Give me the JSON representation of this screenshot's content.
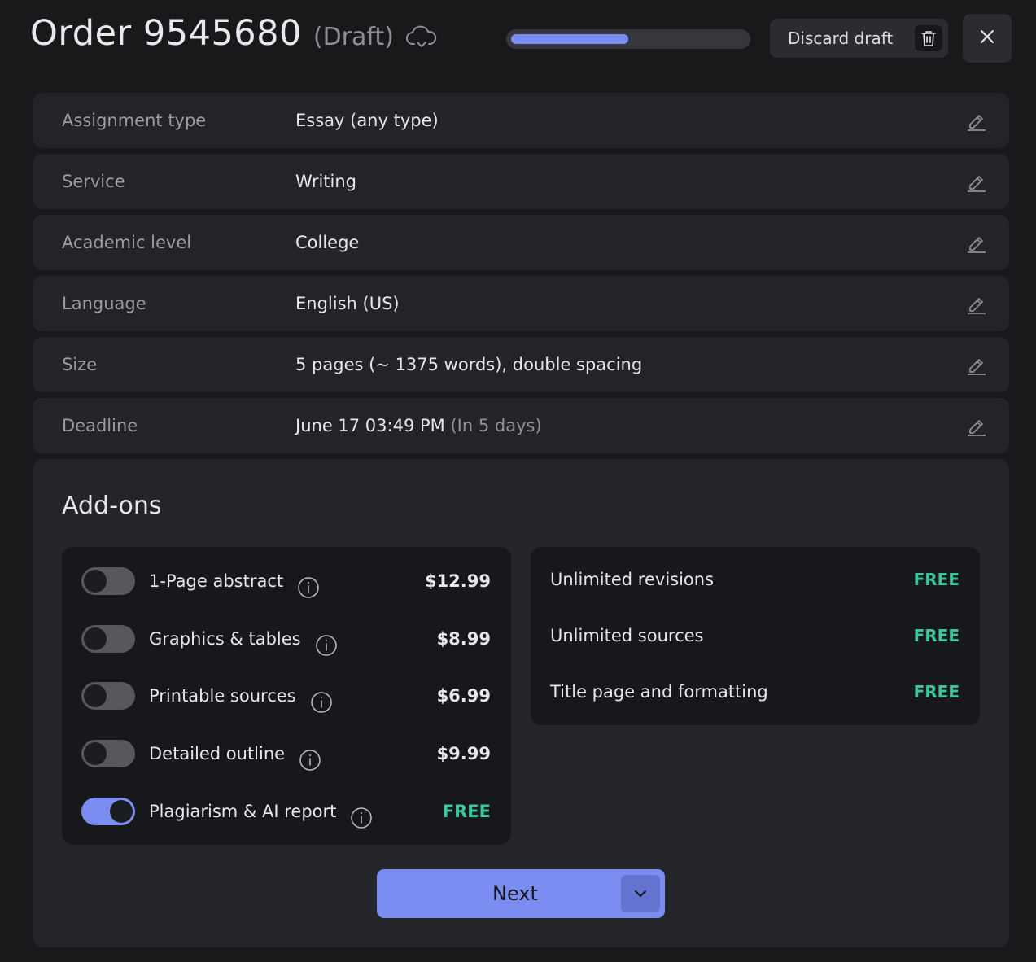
{
  "header": {
    "title": "Order 9545680",
    "status": "(Draft)",
    "progress_percent": 50,
    "discard_label": "Discard draft"
  },
  "details": [
    {
      "label": "Assignment type",
      "value": "Essay (any type)",
      "note": ""
    },
    {
      "label": "Service",
      "value": "Writing",
      "note": ""
    },
    {
      "label": "Academic level",
      "value": "College",
      "note": ""
    },
    {
      "label": "Language",
      "value": "English (US)",
      "note": ""
    },
    {
      "label": "Size",
      "value": "5 pages (~ 1375 words), double spacing",
      "note": ""
    },
    {
      "label": "Deadline",
      "value": "June 17 03:49 PM",
      "note": "(In 5 days)"
    }
  ],
  "addons": {
    "title": "Add-ons",
    "paid": [
      {
        "name": "1-Page abstract",
        "price": "$12.99",
        "enabled": false
      },
      {
        "name": "Graphics & tables",
        "price": "$8.99",
        "enabled": false
      },
      {
        "name": "Printable sources",
        "price": "$6.99",
        "enabled": false
      },
      {
        "name": "Detailed outline",
        "price": "$9.99",
        "enabled": false
      },
      {
        "name": "Plagiarism & AI report",
        "price": "FREE",
        "enabled": true
      }
    ],
    "included": [
      {
        "name": "Unlimited revisions",
        "price": "FREE"
      },
      {
        "name": "Unlimited sources",
        "price": "FREE"
      },
      {
        "name": "Title page and formatting",
        "price": "FREE"
      }
    ]
  },
  "footer": {
    "next_label": "Next"
  },
  "colors": {
    "accent": "#7b8df0",
    "free": "#3cc79a",
    "background": "#19191c",
    "card": "#222429"
  },
  "icons": {
    "draft_status": "cloud-check-icon",
    "discard": "trash-icon",
    "close": "close-icon",
    "edit": "pencil-icon",
    "info": "info-icon",
    "dropdown": "chevron-down-icon"
  }
}
